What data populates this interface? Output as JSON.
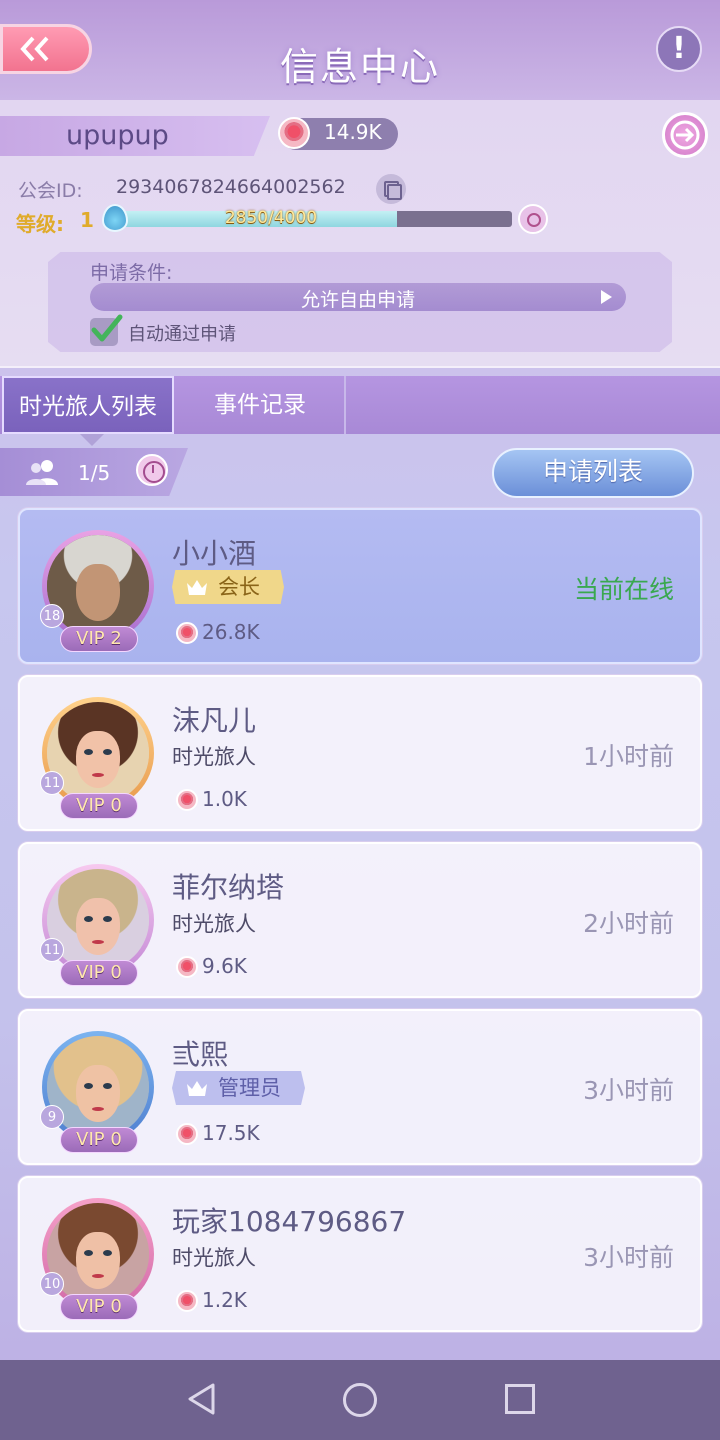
{
  "header": {
    "title": "信息中心"
  },
  "guild": {
    "name": "upupup",
    "roses": "14.9K",
    "id_label": "公会ID:",
    "id_value": "2934067824664002562",
    "level_label": "等级:",
    "level_value": "1",
    "xp_text": "2850/4000",
    "xp_progress": 0.7125
  },
  "conditions": {
    "title": "申请条件:",
    "selected": "允许自由申请",
    "auto_approve_label": "自动通过申请",
    "auto_approve_checked": true
  },
  "tabs": [
    {
      "label": "时光旅人列表",
      "active": true
    },
    {
      "label": "事件记录",
      "active": false
    }
  ],
  "members_header": {
    "count": "1/5",
    "apply_button": "申请列表"
  },
  "members": [
    {
      "name": "小小酒",
      "role": "会长",
      "roses": "26.8K",
      "status": "当前在线",
      "level": "18",
      "vip": "VIP 2"
    },
    {
      "name": "沫凡儿",
      "role": "时光旅人",
      "roses": "1.0K",
      "status": "1小时前",
      "level": "11",
      "vip": "VIP 0"
    },
    {
      "name": "菲尔纳塔",
      "role": "时光旅人",
      "roses": "9.6K",
      "status": "2小时前",
      "level": "11",
      "vip": "VIP 0"
    },
    {
      "name": "弎熙",
      "role": "管理员",
      "roses": "17.5K",
      "status": "3小时前",
      "level": "9",
      "vip": "VIP 0"
    },
    {
      "name": "玩家1084796867",
      "role": "时光旅人",
      "roses": "1.2K",
      "status": "3小时前",
      "level": "10",
      "vip": "VIP 0"
    }
  ],
  "colors": {
    "online": "#3aa84f",
    "accent": "#a889d6",
    "leader_tag": "#f0d78a",
    "admin_tag": "#bdbfee"
  },
  "icons": {
    "back": "double-chevron-left-icon",
    "help": "exclamation-icon",
    "exit": "exit-arrow-icon",
    "rose": "rose-icon",
    "copy": "copy-icon",
    "drop": "water-drop-icon",
    "search": "search-icon",
    "check": "checkmark-icon",
    "people": "people-icon",
    "clock": "clock-icon",
    "crown": "crown-icon"
  }
}
